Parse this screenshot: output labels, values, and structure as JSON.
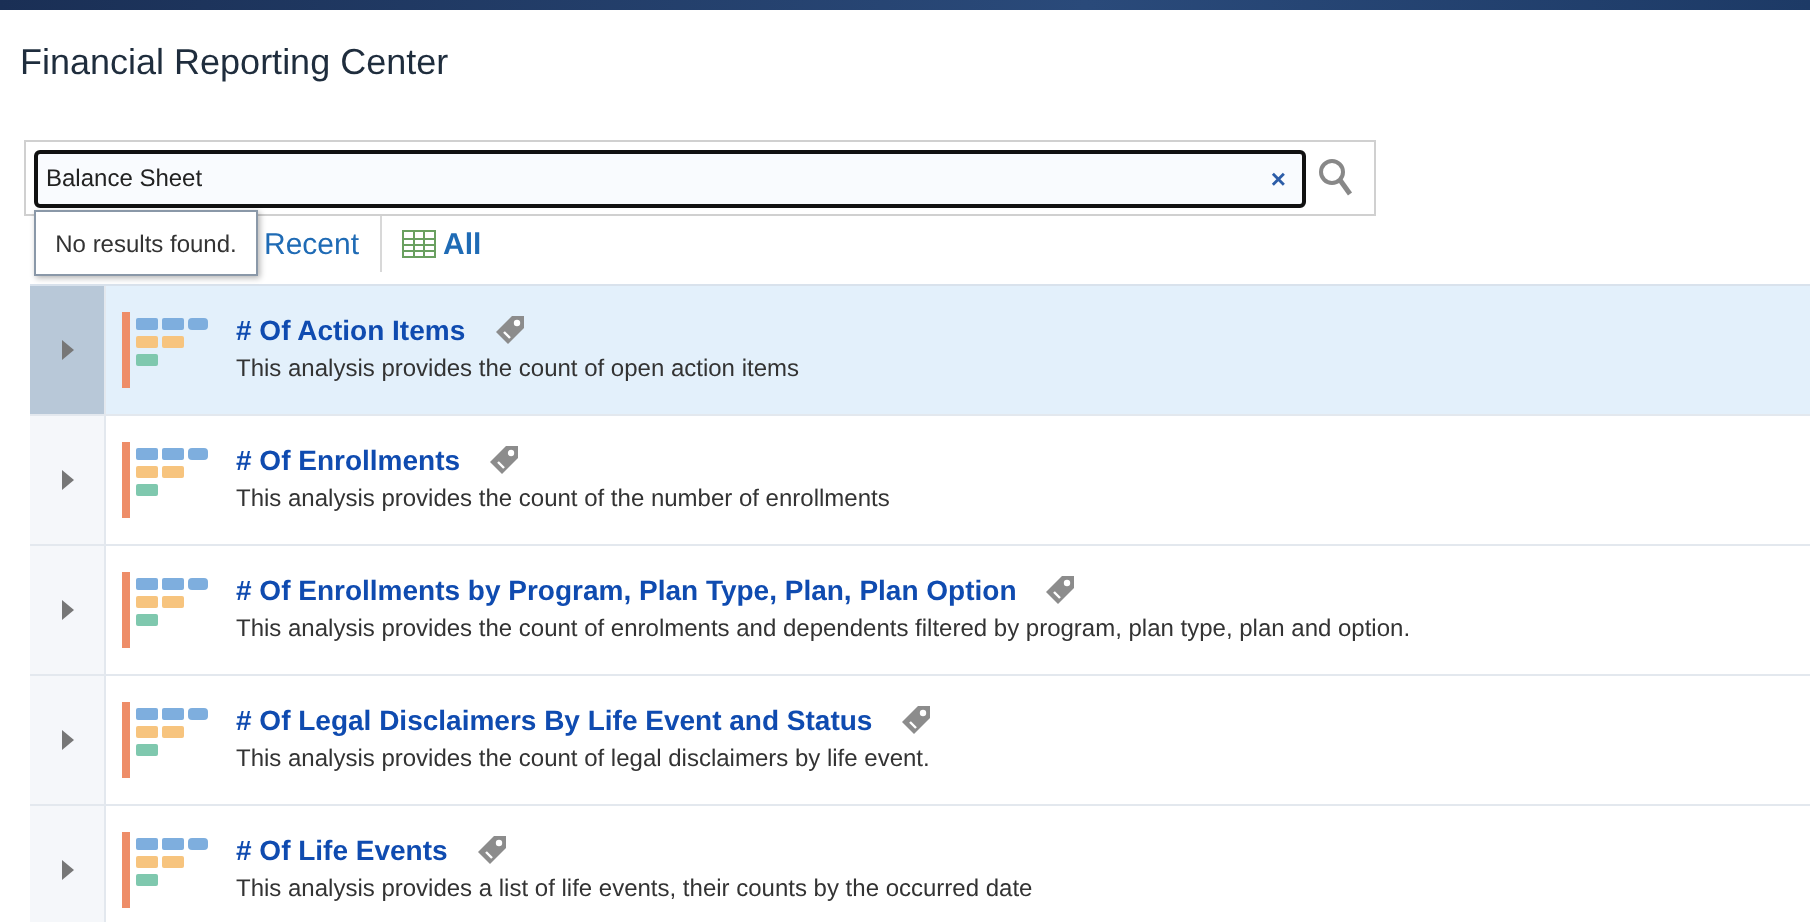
{
  "page": {
    "title": "Financial Reporting Center"
  },
  "search": {
    "value": "Balance Sheet",
    "popup": "No results found.",
    "clear": "×"
  },
  "tabs": [
    {
      "label": "Recent",
      "kind": "recent",
      "selected": false
    },
    {
      "label": "All",
      "kind": "all",
      "selected": true
    }
  ],
  "reports": [
    {
      "title": "# Of Action Items",
      "description": "This analysis provides the count of open action items",
      "selected": true
    },
    {
      "title": "# Of Enrollments",
      "description": "This analysis provides the count of the number of enrollments",
      "selected": false
    },
    {
      "title": "# Of Enrollments by Program, Plan Type, Plan, Plan Option",
      "description": "This analysis provides the count of enrolments and dependents filtered by program, plan type, plan and option.",
      "selected": false
    },
    {
      "title": "# Of Legal Disclaimers By Life Event and Status",
      "description": "This analysis provides the count of legal disclaimers by life event.",
      "selected": false
    },
    {
      "title": "# Of Life Events",
      "description": "This analysis provides a list of life events, their counts by the occurred date",
      "selected": false
    }
  ]
}
